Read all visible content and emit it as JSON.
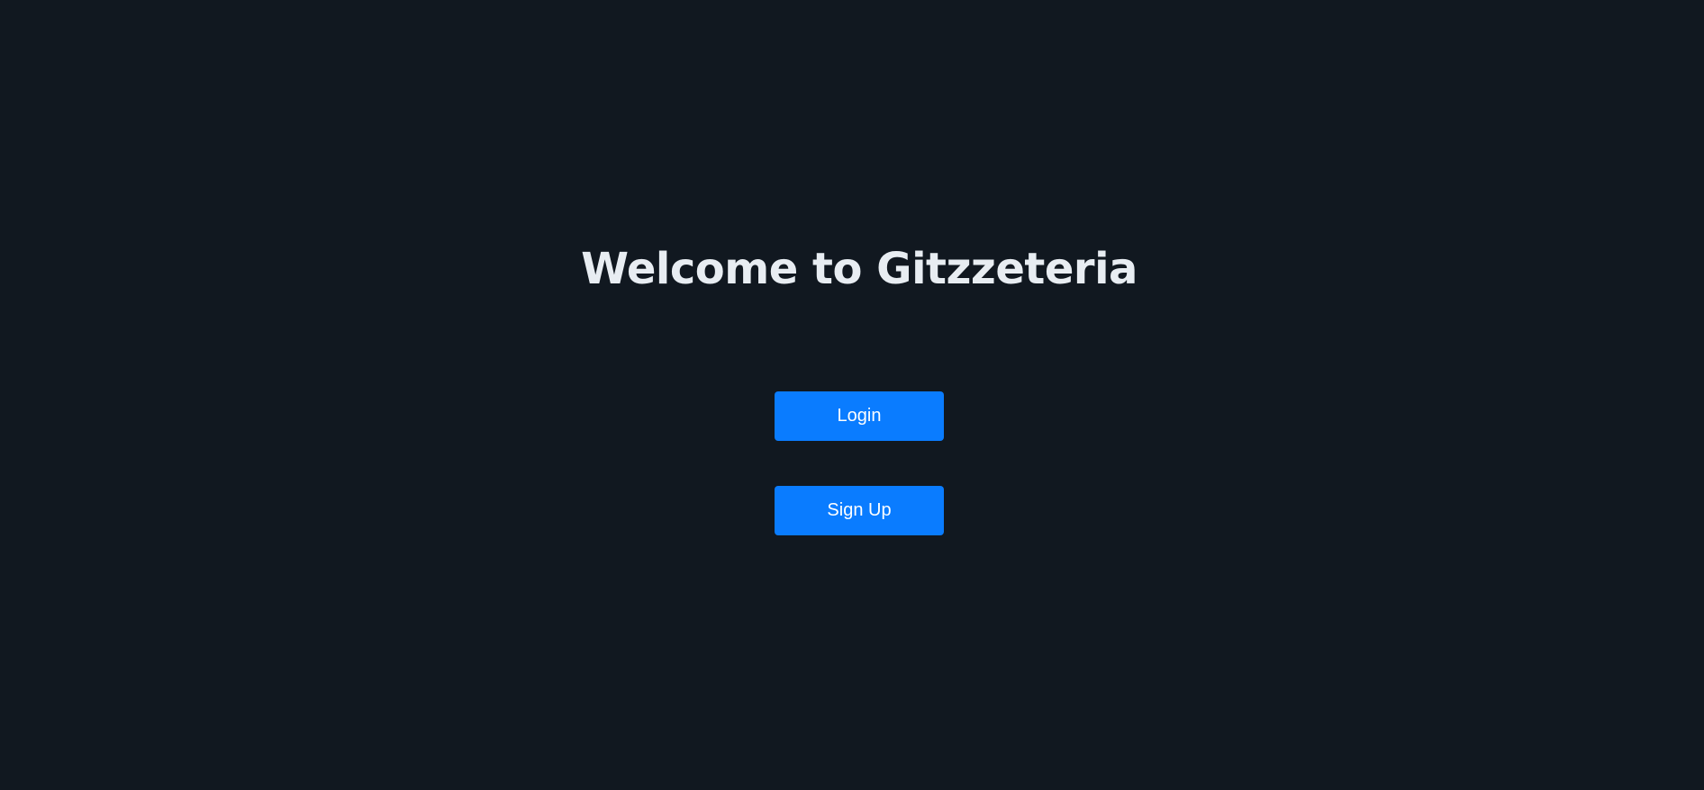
{
  "main": {
    "title": "Welcome to Gitzzeteria",
    "login_label": "Login",
    "signup_label": "Sign Up"
  },
  "colors": {
    "background": "#111820",
    "title_text": "#e8edf2",
    "button_bg": "#0a7cff",
    "button_text": "#ffffff"
  }
}
